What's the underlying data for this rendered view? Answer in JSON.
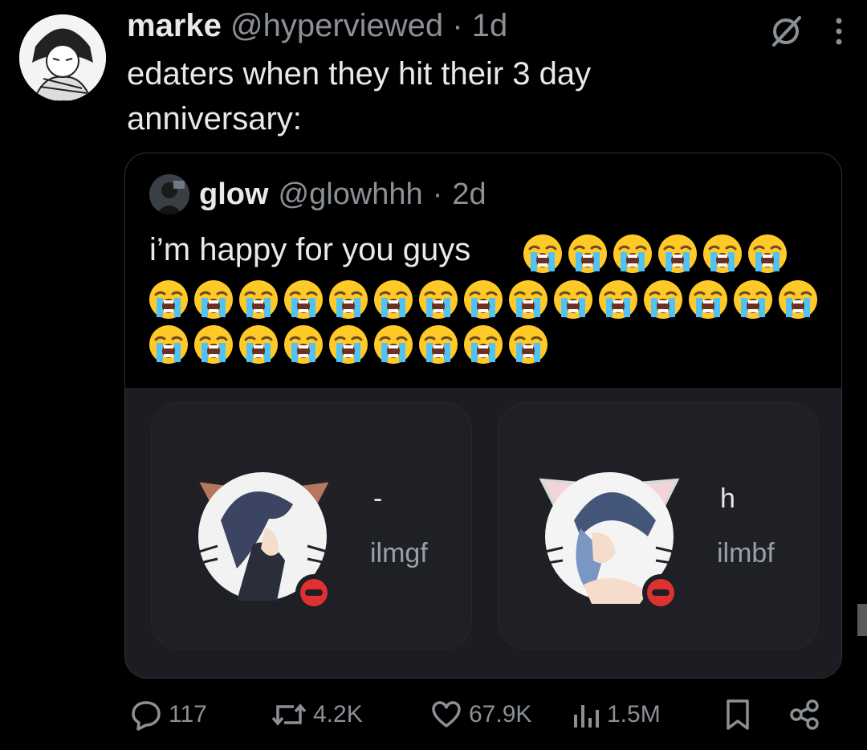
{
  "tweet": {
    "author_name": "marke",
    "author_handle": "@hyperviewed",
    "dot": "·",
    "time": "1d",
    "text": "edaters when they hit their 3 day anniversary:"
  },
  "quote": {
    "author_name": "glow",
    "author_handle": "@glowhhh",
    "dot": "·",
    "time": "2d",
    "text": "i’m happy for you guys",
    "emoji_name": "loudly-crying-face",
    "emoji_rows": [
      6,
      15,
      9
    ]
  },
  "embed": {
    "cards": [
      {
        "title": "-",
        "sub": "ilmgf"
      },
      {
        "title": "h",
        "sub": "ilmbf"
      }
    ]
  },
  "actions": {
    "replies": "117",
    "reposts": "4.2K",
    "likes": "67.9K",
    "views": "1.5M"
  },
  "colors": {
    "background": "#000000",
    "text": "#e7e9ea",
    "muted": "#8b9096",
    "border": "#2f3336",
    "status_red": "#e03131"
  }
}
